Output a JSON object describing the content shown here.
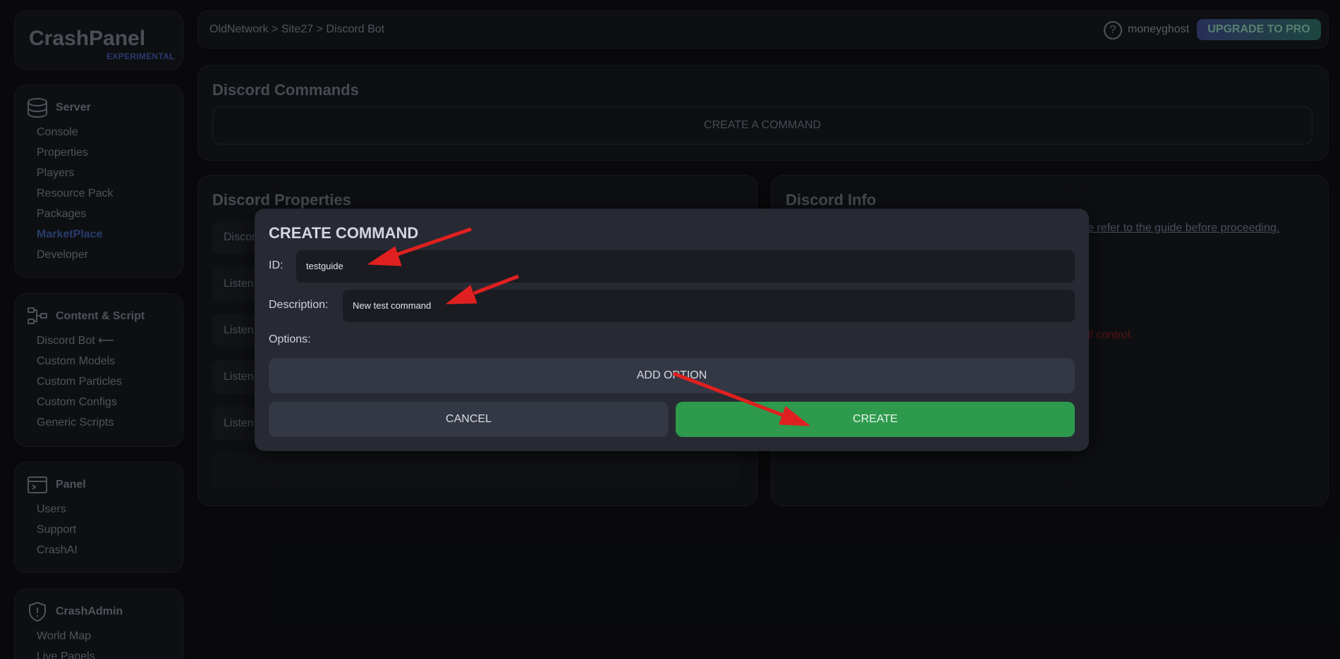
{
  "logo": {
    "name": "CrashPanel",
    "tag": "EXPERIMENTAL"
  },
  "sidebar": {
    "server": {
      "title": "Server",
      "items": [
        "Console",
        "Properties",
        "Players",
        "Resource Pack",
        "Packages",
        "MarketPlace",
        "Developer"
      ]
    },
    "content": {
      "title": "Content & Script",
      "items": [
        "Discord Bot",
        "Custom Models",
        "Custom Particles",
        "Custom Configs",
        "Generic Scripts"
      ]
    },
    "panel": {
      "title": "Panel",
      "items": [
        "Users",
        "Support",
        "CrashAI"
      ]
    },
    "admin": {
      "title": "CrashAdmin",
      "items": [
        "World Map",
        "Live Panels"
      ]
    }
  },
  "topbar": {
    "breadcrumb": "OldNetwork > Site27 > Discord Bot",
    "username": "moneyghost",
    "upgrade_label": "UPGRADE TO PRO",
    "help_glyph": "?"
  },
  "commands": {
    "title": "Discord Commands",
    "create_label": "CREATE A COMMAND"
  },
  "properties": {
    "title": "Discord Properties",
    "rows": [
      "Discor",
      "Listen",
      "Listen",
      "Listen",
      "Listen"
    ]
  },
  "info": {
    "title": "Discord Info",
    "link_text": "se refer to the guide before proceeding.",
    "warning_text": "ull control."
  },
  "modal": {
    "title": "CREATE COMMAND",
    "id_label": "ID:",
    "id_value": "testguide",
    "desc_label": "Description:",
    "desc_value": "New test command",
    "options_label": "Options:",
    "add_option_label": "ADD OPTION",
    "cancel_label": "CANCEL",
    "create_label": "CREATE"
  },
  "colors": {
    "accent_green": "#2e9a4e",
    "annotation_red": "#e02020",
    "active_nav": "#3e5ea8"
  }
}
